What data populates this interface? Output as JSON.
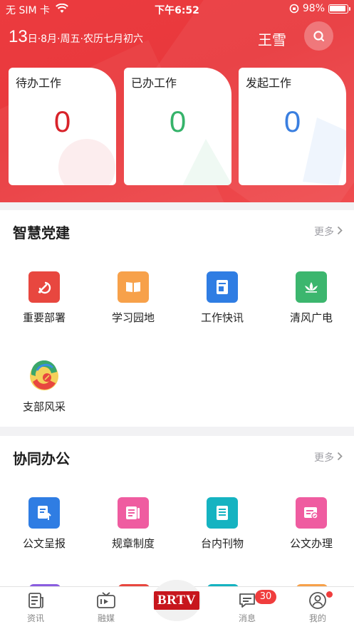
{
  "status_bar": {
    "carrier": "无 SIM 卡",
    "time": "下午6:52",
    "battery": "98%"
  },
  "header": {
    "day": "13",
    "date_rest": "日·8月·周五·农历七月初六",
    "user_name": "王雪"
  },
  "cards": [
    {
      "title": "待办工作",
      "count": "0",
      "color": "#d8232a"
    },
    {
      "title": "已办工作",
      "count": "0",
      "color": "#35b36a"
    },
    {
      "title": "发起工作",
      "count": "0",
      "color": "#3a7fe0"
    }
  ],
  "party": {
    "title": "智慧党建",
    "more": "更多",
    "items": [
      {
        "label": "重要部署",
        "icon": "party-emblem-icon",
        "color": "#e8473f"
      },
      {
        "label": "学习园地",
        "icon": "open-book-icon",
        "color": "#f7a14a"
      },
      {
        "label": "工作快讯",
        "icon": "news-document-icon",
        "color": "#2f7de3"
      },
      {
        "label": "清风广电",
        "icon": "lotus-icon",
        "color": "#3cb66e"
      },
      {
        "label": "支部风采",
        "icon": "branch-logo-icon",
        "color": "#ffffff"
      }
    ]
  },
  "office": {
    "title": "协同办公",
    "more": "更多",
    "items": [
      {
        "label": "公文呈报",
        "icon": "document-upload-icon",
        "color": "#2f7de3"
      },
      {
        "label": "规章制度",
        "icon": "regulation-doc-icon",
        "color": "#ef5ca0"
      },
      {
        "label": "台内刊物",
        "icon": "publication-icon",
        "color": "#15b3c1"
      },
      {
        "label": "公文办理",
        "icon": "document-process-icon",
        "color": "#ef5ca0"
      }
    ]
  },
  "tabbar": {
    "tabs": [
      {
        "label": "资讯"
      },
      {
        "label": "融媒"
      },
      {
        "label": "BRTV"
      },
      {
        "label": "消息",
        "badge": "30"
      },
      {
        "label": "我的"
      }
    ]
  }
}
